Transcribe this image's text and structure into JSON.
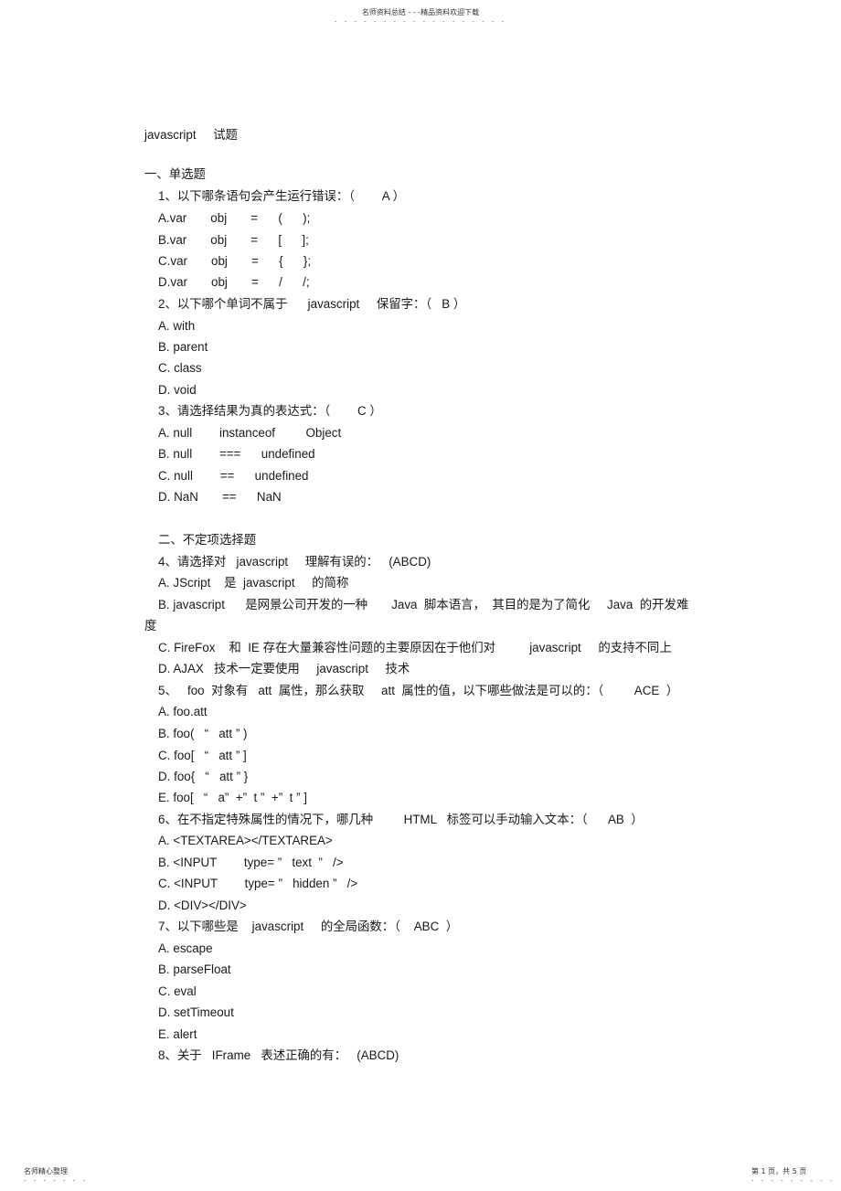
{
  "header": {
    "text": "名师资料总结 - - -精品资料欢迎下载",
    "dots": "- - - - - - - - - - - - - - - - - -"
  },
  "footer": {
    "left": "名师精心整理",
    "left_dots": "- - - - - - -",
    "right": "第 1 页，共 5 页",
    "right_dots": "- - - - - - - - -"
  },
  "document": {
    "title": "javascript     试题",
    "sections": [
      {
        "heading": "一、单选题",
        "questions": [
          {
            "prompt": "1、以下哪条语句会产生运行错误：（        A ）",
            "options": [
              "A.var       obj       =      (      );",
              "B.var       obj       =      [      ];",
              "C.var       obj       =      {      };",
              "D.var       obj       =      /      /;"
            ]
          },
          {
            "prompt": "2、以下哪个单词不属于      javascript     保留字：（   B ）",
            "options": [
              "A. with",
              "B. parent",
              "C. class",
              "D. void"
            ]
          },
          {
            "prompt": "3、请选择结果为真的表达式：（        C ）",
            "options": [
              "A. null        instanceof         Object",
              "B. null        ===      undefined",
              "C. null        ==      undefined",
              "D. NaN       ==      NaN"
            ]
          }
        ]
      },
      {
        "heading": "二、不定项选择题",
        "questions": [
          {
            "prompt": "4、请选择对   javascript     理解有误的：   (ABCD)",
            "options": [
              "A. JScript    是  javascript     的简称",
              "B. javascript      是网景公司开发的一种       Java  脚本语言，  其目的是为了简化     Java  的开发难",
              "度",
              "C. FireFox    和  IE 存在大量兼容性问题的主要原因在于他们对          javascript     的支持不同上",
              "D. AJAX   技术一定要使用     javascript     技术"
            ]
          },
          {
            "prompt": "5、   foo  对象有   att  属性，那么获取     att  属性的值，以下哪些做法是可以的：（         ACE  ）",
            "options": [
              "A. foo.att",
              "B. foo(   “   att ” )",
              "C. foo[   “   att ” ]",
              "D. foo{   “   att ” }",
              "E. foo[   “   a”  +”  t ”  +”  t ” ]"
            ]
          },
          {
            "prompt": "6、在不指定特殊属性的情况下，哪几种         HTML   标签可以手动输入文本：（      AB  ）",
            "options": [
              "A. <TEXTAREA></TEXTAREA>",
              "B. <INPUT        type= ”   text  ”   />",
              "C. <INPUT        type= ”   hidden ”   />",
              "D. <DIV></DIV>"
            ]
          },
          {
            "prompt": "7、以下哪些是    javascript     的全局函数：（    ABC  ）",
            "options": [
              "A. escape",
              "B. parseFloat",
              "C. eval",
              "D. setTimeout",
              "E. alert"
            ]
          },
          {
            "prompt": "8、关于   IFrame   表述正确的有：   (ABCD)",
            "options": []
          }
        ]
      }
    ]
  }
}
